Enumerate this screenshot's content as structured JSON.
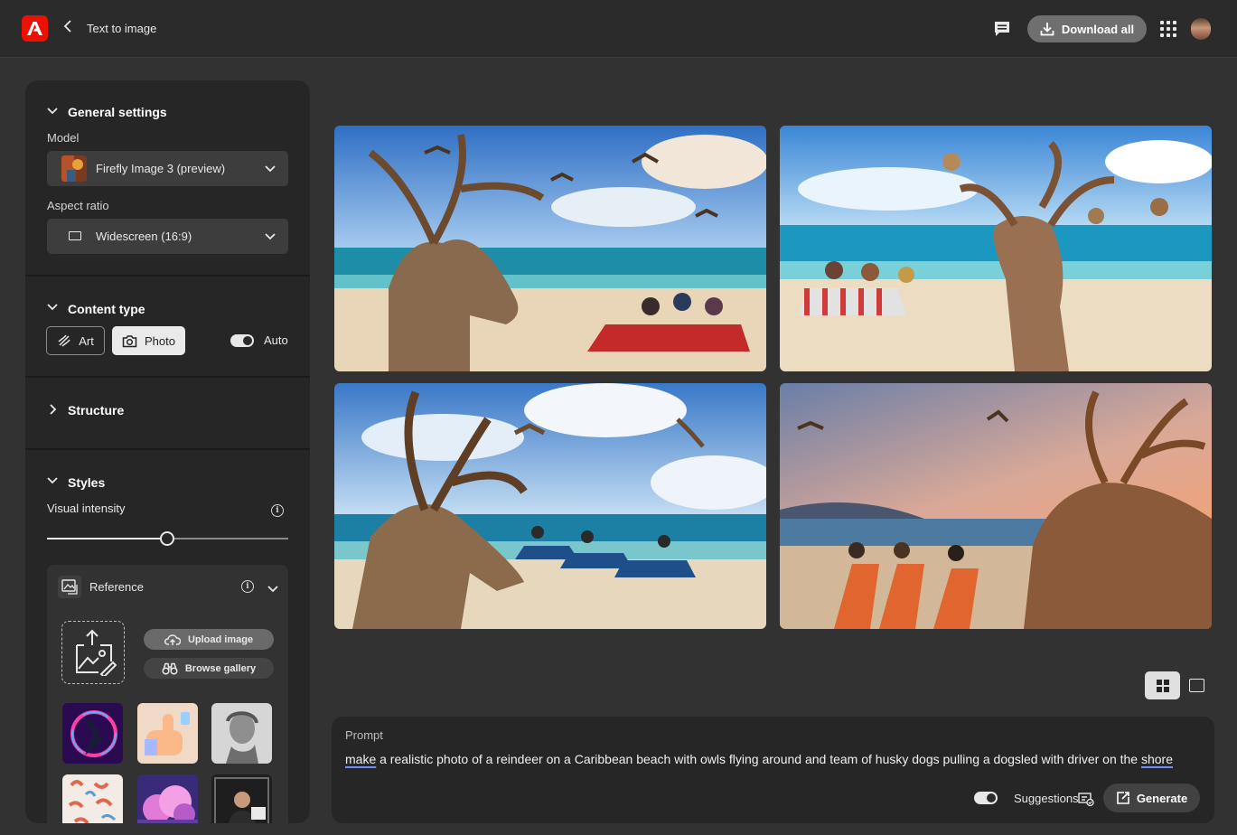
{
  "header": {
    "title": "Text to image",
    "download_label": "Download all"
  },
  "sidebar": {
    "general": {
      "heading": "General settings",
      "model_label": "Model",
      "model_value": "Firefly Image 3 (preview)",
      "aspect_label": "Aspect ratio",
      "aspect_value": "Widescreen (16:9)"
    },
    "content_type": {
      "heading": "Content type",
      "art_label": "Art",
      "photo_label": "Photo",
      "auto_label": "Auto",
      "selected": "Photo",
      "auto_on": true
    },
    "structure": {
      "heading": "Structure"
    },
    "styles": {
      "heading": "Styles",
      "intensity_label": "Visual intensity",
      "intensity_value": 0.5,
      "reference_label": "Reference",
      "upload_label": "Upload image",
      "browse_label": "Browse gallery"
    }
  },
  "prompt": {
    "label": "Prompt",
    "text_start": "make",
    "text_middle": " a realistic photo of a reindeer on a Caribbean beach with owls flying around and team of husky dogs pulling a dogsled with driver on the ",
    "text_end": "shore",
    "suggestions_label": "Suggestions",
    "suggestions_on": true,
    "generate_label": "Generate"
  },
  "colors": {
    "accent": "#eb1000",
    "background": "#323232",
    "panel": "#262626"
  }
}
